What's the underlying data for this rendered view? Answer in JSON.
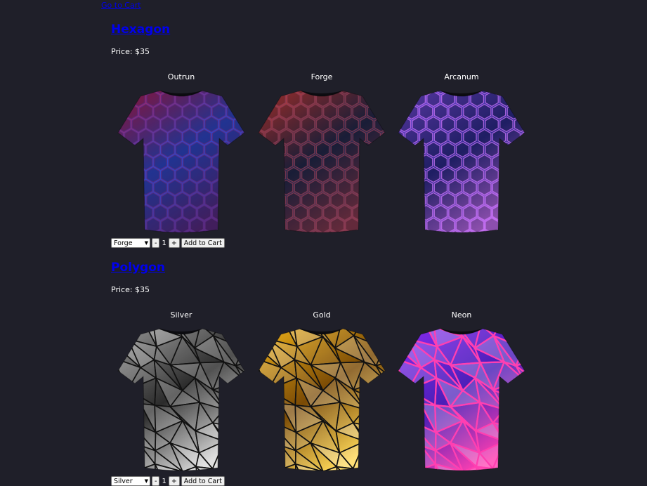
{
  "nav": {
    "cart_link": "Go to Cart"
  },
  "products": [
    {
      "title": "Hexagon",
      "price": "Price: $35",
      "variants": [
        {
          "name": "Outrun",
          "pattern": "hex",
          "colors": [
            "#c31a4a",
            "#2f47c9",
            "#5a2a80"
          ]
        },
        {
          "name": "Forge",
          "pattern": "hex",
          "colors": [
            "#e0403a",
            "#23294d",
            "#8a3b52"
          ]
        },
        {
          "name": "Arcanum",
          "pattern": "hex",
          "colors": [
            "#7b4ee2",
            "#2b2a8a",
            "#c36ef0"
          ]
        }
      ],
      "controls": {
        "selected": "Forge",
        "minus": "-",
        "qty": "1",
        "plus": "+",
        "add": "Add to Cart"
      }
    },
    {
      "title": "Polygon",
      "price": "Price: $35",
      "variants": [
        {
          "name": "Silver",
          "pattern": "poly",
          "colors": [
            "#9a9a9a",
            "#2b2b2b",
            "#d8d8d8"
          ]
        },
        {
          "name": "Gold",
          "pattern": "poly",
          "colors": [
            "#f5b71a",
            "#7a4a05",
            "#ffd95a"
          ]
        },
        {
          "name": "Neon",
          "pattern": "poly",
          "colors": [
            "#8b2cf2",
            "#4b1fb8",
            "#ff3fb1"
          ]
        }
      ],
      "controls": {
        "selected": "Silver",
        "minus": "-",
        "qty": "1",
        "plus": "+",
        "add": "Add to Cart"
      }
    }
  ]
}
